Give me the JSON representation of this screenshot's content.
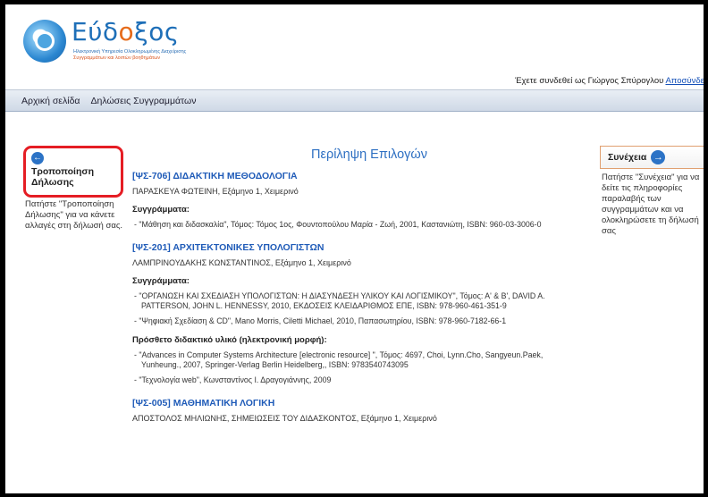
{
  "logo": {
    "title_start": "Εύδ",
    "title_o": "ο",
    "title_end": "ξος",
    "subtitle_line1": "Ηλεκτρονική Υπηρεσία Ολοκληρωμένης Διαχείρισης",
    "subtitle_line2": "Συγγραμμάτων και λοιπών βοηθημάτων"
  },
  "header": {
    "user_text": "Έχετε συνδεθεί ως Γιώργος Σπύρογλου",
    "logout_link": "Αποσύνδεση"
  },
  "nav": {
    "items": [
      "Αρχική σελίδα",
      "Δηλώσεις Συγγραμμάτων"
    ]
  },
  "left": {
    "back_icon": "left-arrow-icon",
    "back_label": "Τροποποίηση Δήλωσης",
    "help_text": "Πατήστε \"Τροποποίηση Δήλωσης\" για να κάνετε αλλαγές στη δήλωσή σας."
  },
  "main": {
    "title": "Περίληψη Επιλογών",
    "courses": [
      {
        "title": "[ΨΣ-706] ΔΙΔΑΚΤΙΚΗ ΜΕΘΟΔΟΛΟΓΙΑ",
        "sub": "ΠΑΡΑΣΚΕΥΑ ΦΩΤΕΙΝΗ, Εξάμηνο 1, Χειμερινό",
        "books_heading": "Συγγράμματα:",
        "books": [
          "- \"Μάθηση και διδασκαλία\", Τόμος: Τόμος 1ος, Φουντοπούλου Μαρία - Ζωή, 2001, Καστανιώτη, ISBN: 960-03-3006-0"
        ]
      },
      {
        "title": "[ΨΣ-201] ΑΡΧΙΤΕΚΤΟΝΙΚΕΣ ΥΠΟΛΟΓΙΣΤΩΝ",
        "sub": "ΛΑΜΠΡΙΝΟΥΔΑΚΗΣ ΚΩΝΣΤΑΝΤΙΝΟΣ, Εξάμηνο 1, Χειμερινό",
        "books_heading": "Συγγράμματα:",
        "books": [
          "- \"ΟΡΓΑΝΩΣΗ ΚΑΙ ΣΧΕΔΙΑΣΗ ΥΠΟΛΟΓΙΣΤΩΝ: Η ΔΙΑΣΥΝΔΕΣΗ ΥΛΙΚΟΥ ΚΑΙ ΛΟΓΙΣΜΙΚΟΥ\", Τόμος: Α' & Β', DAVID A. PATTERSON, JOHN L. HENNESSY, 2010, ΕΚΔΟΣΕΙΣ ΚΛΕΙΔΑΡΙΘΜΟΣ ΕΠΕ, ISBN: 978-960-461-351-9",
          "- \"Ψηφιακή Σχεδίαση & CD\", Mano Morris, Ciletti Michael, 2010, Παπασωτηρίου, ISBN: 978-960-7182-66-1"
        ],
        "extra_heading": "Πρόσθετο διδακτικό υλικό (ηλεκτρονική μορφή):",
        "extra": [
          "- \"Advances in Computer Systems Architecture [electronic resource] \", Τόμος: 4697, Choi, Lynn.Cho, Sangyeun.Paek, Yunheung., 2007, Springer-Verlag Berlin Heidelberg,, ISBN: 9783540743095",
          "- \"Τεχνολογία web\", Κωνσταντίνος Ι. Δραγογιάννης, 2009"
        ]
      },
      {
        "title": "[ΨΣ-005] ΜΑΘΗΜΑΤΙΚΗ ΛΟΓΙΚΗ",
        "sub": "ΑΠΟΣΤΟΛΟΣ ΜΗΛΙΩΝΗΣ, ΣΗΜΕΙΩΣΕΙΣ ΤΟΥ ΔΙΔΑΣΚΟΝΤΟΣ, Εξάμηνο 1, Χειμερινό"
      }
    ]
  },
  "right": {
    "next_label": "Συνέχεια",
    "next_icon": "right-arrow-icon",
    "help_text": "Πατήστε \"Συνέχεια\" για να δείτε τις πληροφορίες παραλαβής των συγγραμμάτων και να ολοκληρώσετε τη δήλωσή σας"
  },
  "colors": {
    "link_blue": "#1f5bb8",
    "highlight_red": "#e51d24",
    "accent_orange": "#e66b1a"
  }
}
